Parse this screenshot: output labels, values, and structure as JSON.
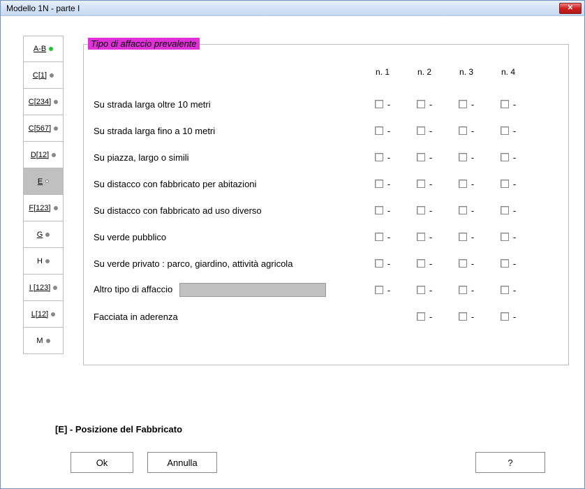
{
  "window": {
    "title": "Modello 1N  -   parte I"
  },
  "sidebar": {
    "items": [
      {
        "label": "A-B",
        "underline": true,
        "dot": "green",
        "active": false
      },
      {
        "label": "C[1]",
        "underline": true,
        "dot": "grey",
        "active": false
      },
      {
        "label": "C[234]",
        "underline": true,
        "dot": "grey",
        "active": false
      },
      {
        "label": "C[567]",
        "underline": true,
        "dot": "grey",
        "active": false
      },
      {
        "label": "D[12]",
        "underline": true,
        "dot": "grey",
        "active": false
      },
      {
        "label": "E",
        "underline": true,
        "dot": "active",
        "active": true
      },
      {
        "label": "F[123]",
        "underline": true,
        "dot": "grey",
        "active": false
      },
      {
        "label": "G",
        "underline": true,
        "dot": "grey",
        "active": false
      },
      {
        "label": "H",
        "underline": false,
        "dot": "grey",
        "active": false
      },
      {
        "label": "I [123]",
        "underline": true,
        "dot": "grey",
        "active": false
      },
      {
        "label": "L[12]",
        "underline": true,
        "dot": "grey",
        "active": false
      },
      {
        "label": "M",
        "underline": false,
        "dot": "grey",
        "active": false
      }
    ]
  },
  "group": {
    "title": "Tipo di affaccio prevalente",
    "columns": [
      "n. 1",
      "n. 2",
      "n. 3",
      "n. 4"
    ],
    "rows": [
      {
        "label": "Su strada larga oltre 10 metri",
        "cells": [
          true,
          true,
          true,
          true
        ]
      },
      {
        "label": "Su strada larga fino a 10 metri",
        "cells": [
          true,
          true,
          true,
          true
        ]
      },
      {
        "label": "Su piazza, largo o simili",
        "cells": [
          true,
          true,
          true,
          true
        ]
      },
      {
        "label": "Su distacco con fabbricato per abitazioni",
        "cells": [
          true,
          true,
          true,
          true
        ]
      },
      {
        "label": "Su distacco con fabbricato ad uso diverso",
        "cells": [
          true,
          true,
          true,
          true
        ]
      },
      {
        "label": "Su verde pubblico",
        "cells": [
          true,
          true,
          true,
          true
        ]
      },
      {
        "label": "Su verde privato : parco, giardino,     attività agricola",
        "cells": [
          true,
          true,
          true,
          true
        ]
      },
      {
        "label": "Altro tipo di affaccio",
        "cells": [
          true,
          true,
          true,
          true
        ],
        "has_input": true
      },
      {
        "label": "Facciata in aderenza",
        "cells": [
          false,
          true,
          true,
          true
        ]
      }
    ],
    "altro_value": ""
  },
  "footer": {
    "section_label": "[E] - Posizione del Fabbricato",
    "ok": "Ok",
    "cancel": "Annulla",
    "help": "?"
  }
}
